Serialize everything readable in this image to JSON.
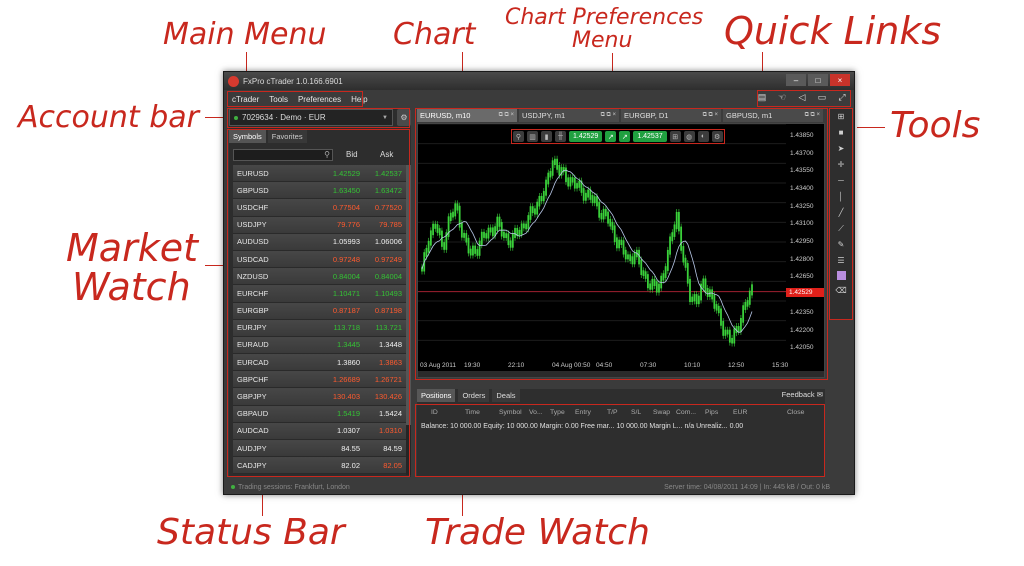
{
  "callouts": {
    "main_menu": "Main Menu",
    "chart": "Chart",
    "chart_prefs_line1": "Chart Preferences",
    "chart_prefs_line2": "Menu",
    "quick_links": "Quick Links",
    "account_bar": "Account bar",
    "tools": "Tools",
    "market_watch_line1": "Market",
    "market_watch_line2": "Watch",
    "status_bar": "Status Bar",
    "trade_watch": "Trade Watch"
  },
  "window": {
    "title": "FxPro cTrader 1.0.166.6901"
  },
  "menu": [
    "cTrader",
    "Tools",
    "Preferences",
    "Help"
  ],
  "account": {
    "label": "7029634 · Demo · EUR"
  },
  "market_watch": {
    "tabs": [
      "Symbols",
      "Favorites"
    ],
    "bid_header": "Bid",
    "ask_header": "Ask",
    "rows": [
      {
        "sym": "EURUSD",
        "bid": "1.42529",
        "ask": "1.42537",
        "dir": "up"
      },
      {
        "sym": "GBPUSD",
        "bid": "1.63450",
        "ask": "1.63472",
        "dir": "up"
      },
      {
        "sym": "USDCHF",
        "bid": "0.77504",
        "ask": "0.77520",
        "dir": "down"
      },
      {
        "sym": "USDJPY",
        "bid": "79.776",
        "ask": "79.785",
        "dir": "down"
      },
      {
        "sym": "AUDUSD",
        "bid": "1.05993",
        "ask": "1.06006",
        "dir": "neutral"
      },
      {
        "sym": "USDCAD",
        "bid": "0.97248",
        "ask": "0.97249",
        "dir": "down"
      },
      {
        "sym": "NZDUSD",
        "bid": "0.84004",
        "ask": "0.84004",
        "dir": "up"
      },
      {
        "sym": "EURCHF",
        "bid": "1.10471",
        "ask": "1.10493",
        "dir": "up"
      },
      {
        "sym": "EURGBP",
        "bid": "0.87187",
        "ask": "0.87198",
        "dir": "down"
      },
      {
        "sym": "EURJPY",
        "bid": "113.718",
        "ask": "113.721",
        "dir": "up"
      },
      {
        "sym": "EURAUD",
        "bid": "1.3445",
        "ask": "1.3448",
        "dir": "upbid"
      },
      {
        "sym": "EURCAD",
        "bid": "1.3860",
        "ask": "1.3863",
        "dir": "downask"
      },
      {
        "sym": "GBPCHF",
        "bid": "1.26689",
        "ask": "1.26721",
        "dir": "down"
      },
      {
        "sym": "GBPJPY",
        "bid": "130.403",
        "ask": "130.426",
        "dir": "down"
      },
      {
        "sym": "GBPAUD",
        "bid": "1.5419",
        "ask": "1.5424",
        "dir": "upbid"
      },
      {
        "sym": "AUDCAD",
        "bid": "1.0307",
        "ask": "1.0310",
        "dir": "downask"
      },
      {
        "sym": "AUDJPY",
        "bid": "84.55",
        "ask": "84.59",
        "dir": "neutral"
      },
      {
        "sym": "CADJPY",
        "bid": "82.02",
        "ask": "82.05",
        "dir": "downask"
      }
    ]
  },
  "chart_tabs": [
    {
      "label": "EURUSD, m10",
      "active": true
    },
    {
      "label": "USDJPY, m1",
      "active": false
    },
    {
      "label": "EURGBP, D1",
      "active": false
    },
    {
      "label": "GBPUSD, m1",
      "active": false
    }
  ],
  "chart_prefs": {
    "bid_price": "1.42529",
    "ask_price": "1.42537"
  },
  "chart_data": {
    "type": "bar",
    "title": "EURUSD, m10",
    "price_ticks": [
      "1.43850",
      "1.43700",
      "1.43550",
      "1.43400",
      "1.43250",
      "1.43100",
      "1.42950",
      "1.42800",
      "1.42650",
      "1.42529",
      "1.42350",
      "1.42200",
      "1.42050"
    ],
    "current_price": "1.42529",
    "time_ticks": [
      "03 Aug 2011",
      "19:30",
      "22:10",
      "04 Aug 00:50",
      "04:50",
      "07:30",
      "10:10",
      "12:50",
      "15:30"
    ],
    "ylim": [
      1.4195,
      1.4395
    ],
    "close": [
      1.427,
      1.43,
      1.431,
      1.429,
      1.4315,
      1.4325,
      1.43,
      1.4285,
      1.429,
      1.43,
      1.4305,
      1.431,
      1.43,
      1.4295,
      1.4305,
      1.431,
      1.432,
      1.433,
      1.434,
      1.4365,
      1.4355,
      1.435,
      1.4345,
      1.434,
      1.4335,
      1.433,
      1.432,
      1.4315,
      1.43,
      1.429,
      1.428,
      1.4285,
      1.427,
      1.426,
      1.4255,
      1.4265,
      1.429,
      1.432,
      1.428,
      1.425,
      1.4245,
      1.426,
      1.425,
      1.4235,
      1.422,
      1.421,
      1.4225,
      1.424,
      1.4255
    ]
  },
  "tools": [
    "grid-icon",
    "square-icon",
    "pointer-icon",
    "crosshair-icon",
    "horizontal-line-icon",
    "vertical-line-icon",
    "line-icon",
    "trend-icon",
    "pencil-icon",
    "text-icon",
    "color-icon",
    "eraser-icon"
  ],
  "trade_watch": {
    "tabs": [
      "Positions",
      "Orders",
      "Deals"
    ],
    "feedback": "Feedback",
    "columns": [
      "ID",
      "Time",
      "Symbol",
      "Vo...",
      "Type",
      "Entry",
      "T/P",
      "S/L",
      "Swap",
      "Com...",
      "Pips",
      "EUR",
      "Close"
    ],
    "balance_line": "Balance: 10 000.00   Equity: 10 000.00   Margin: 0.00   Free mar...   10 000.00   Margin L... n/a   Unrealiz...   0.00"
  },
  "status": {
    "left": "Trading sessions: Frankfurt, London",
    "right": "Server time: 04/08/2011 14:09  |  In: 445 kB / Out: 0 kB"
  },
  "colors": {
    "accent": "#c8281e",
    "up": "#34c234",
    "down": "#ff5a2e",
    "candle": "#3ad13a"
  }
}
